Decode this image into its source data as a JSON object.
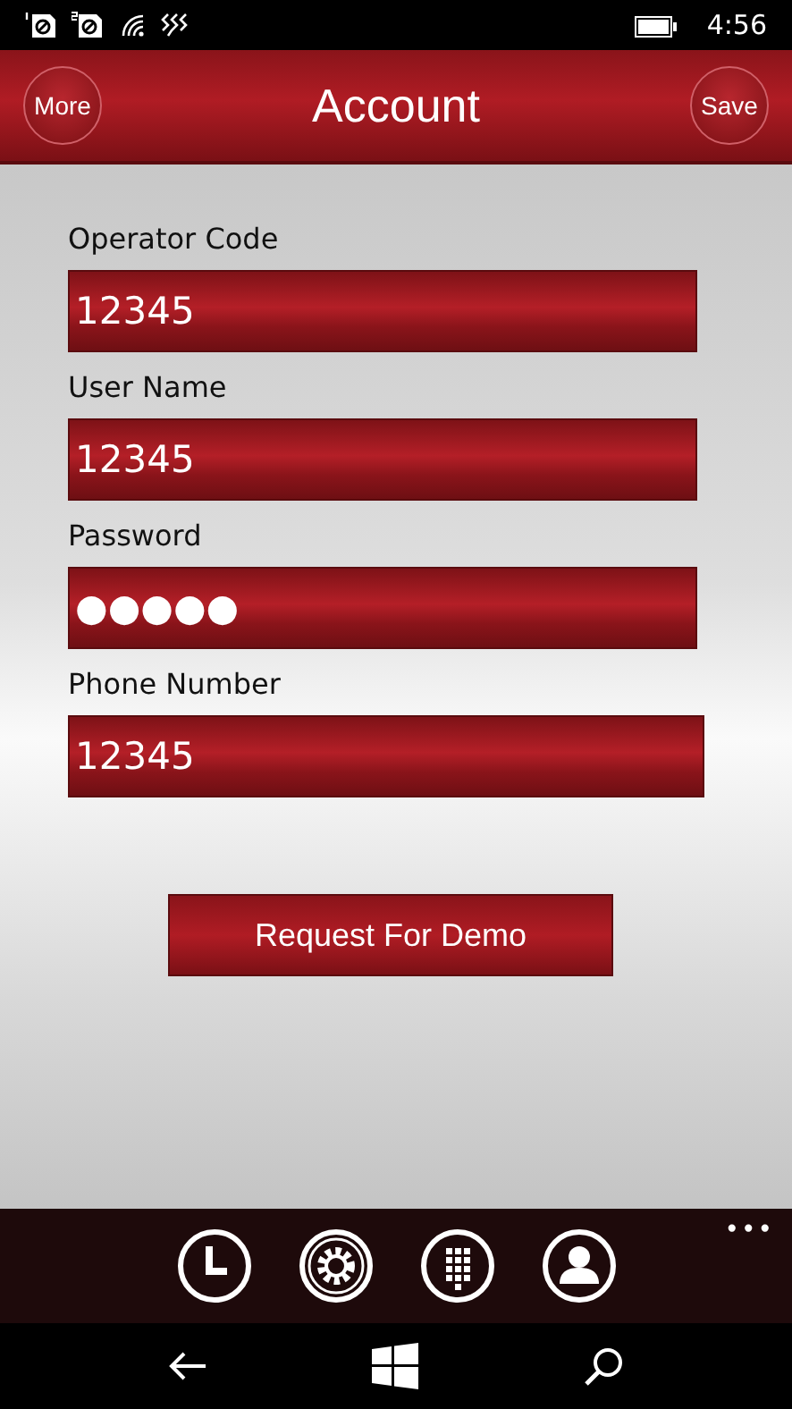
{
  "status_bar": {
    "icons": [
      {
        "kind": "sim1"
      },
      {
        "kind": "sim2"
      },
      {
        "kind": "wifi"
      },
      {
        "kind": "vibrate"
      }
    ],
    "battery": {
      "kind": "battery"
    },
    "time": "4:56"
  },
  "header": {
    "left_button": "More",
    "title": "Account",
    "right_button": "Save"
  },
  "fields": [
    {
      "label": "Operator Code",
      "value": "12345"
    },
    {
      "label": "User Name",
      "value": "12345"
    },
    {
      "label": "Password",
      "value": "●●●●●"
    },
    {
      "label": "Phone Number",
      "value": "12345"
    }
  ],
  "demo_button": "Request For Demo",
  "app_bar": {
    "buttons": [
      {
        "kind": "clock"
      },
      {
        "kind": "gear"
      },
      {
        "kind": "keypad"
      },
      {
        "kind": "person"
      }
    ],
    "more": "•••"
  },
  "nav_bar": [
    {
      "kind": "back"
    },
    {
      "kind": "windows"
    },
    {
      "kind": "search"
    }
  ]
}
